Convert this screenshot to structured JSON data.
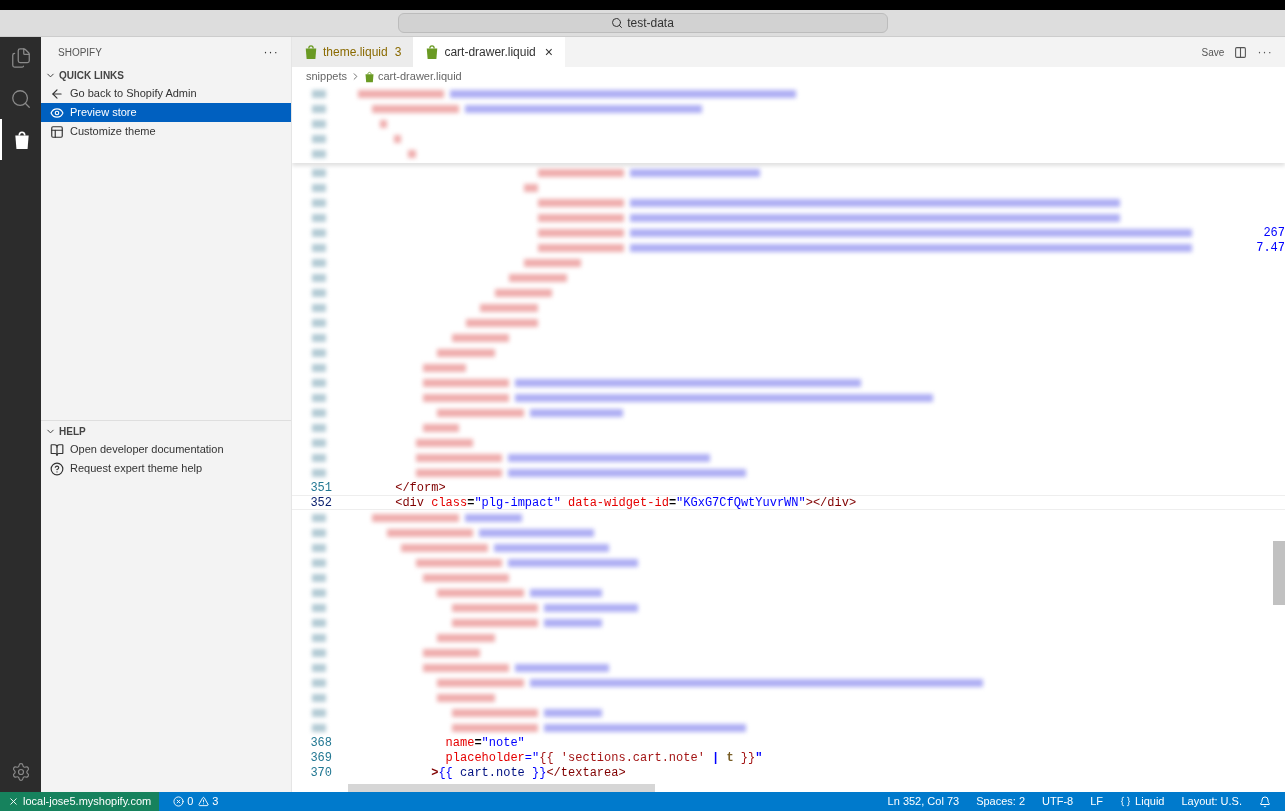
{
  "title_bar": {
    "search": "test-data"
  },
  "activity_bar": [
    {
      "kind": "files",
      "selected": false
    },
    {
      "kind": "search",
      "selected": false
    },
    {
      "kind": "shopify",
      "selected": true
    }
  ],
  "sidebar": {
    "title": "SHOPIFY",
    "more": "···",
    "sections": [
      {
        "title": "QUICK LINKS",
        "expanded": true,
        "items": [
          {
            "kind": "back",
            "label": "Go back to Shopify Admin",
            "selected": false
          },
          {
            "kind": "preview",
            "label": "Preview store",
            "selected": true
          },
          {
            "kind": "customize",
            "label": "Customize theme",
            "selected": false
          }
        ]
      },
      {
        "title": "HELP",
        "expanded": true,
        "items": [
          {
            "kind": "docs",
            "label": "Open developer documentation",
            "selected": false
          },
          {
            "kind": "help",
            "label": "Request expert theme help",
            "selected": false
          }
        ]
      }
    ]
  },
  "tabs": [
    {
      "label": "theme.liquid",
      "badge": "3",
      "selected": false
    },
    {
      "label": "cart-drawer.liquid",
      "close": "×",
      "selected": true
    }
  ],
  "editor_actions": {
    "save": "Save",
    "more": "···"
  },
  "breadcrumb": [
    "snippets",
    "cart-drawer.liquid"
  ],
  "sticky_lines": [
    {
      "kind": "blurred"
    },
    {
      "kind": "blurred"
    },
    {
      "kind": "blurred"
    },
    {
      "kind": "blurred"
    },
    {
      "kind": "blurred"
    }
  ],
  "code_lines": [
    {
      "kind": "blurred"
    },
    {
      "kind": "blurred"
    },
    {
      "kind": "blurred"
    },
    {
      "kind": "blurred"
    },
    {
      "kind": "blurred",
      "tail": "267"
    },
    {
      "kind": "blurred",
      "tail": "7.47"
    },
    {
      "kind": "blurred"
    },
    {
      "kind": "blurred"
    },
    {
      "kind": "blurred"
    },
    {
      "kind": "blurred"
    },
    {
      "kind": "blurred"
    },
    {
      "kind": "blurred"
    },
    {
      "kind": "blurred"
    },
    {
      "kind": "blurred"
    },
    {
      "kind": "blurred"
    },
    {
      "kind": "blurred"
    },
    {
      "kind": "blurred"
    },
    {
      "kind": "blurred"
    },
    {
      "kind": "blurred"
    },
    {
      "kind": "blurred"
    },
    {
      "kind": "blurred"
    },
    {
      "kind": "code",
      "number": "351",
      "current": false,
      "tokens": [
        {
          "text": "</form>",
          "color": "#800000"
        }
      ]
    },
    {
      "kind": "code",
      "number": "352",
      "current": true,
      "tokens": [
        {
          "text": "<div",
          "color": "#800000"
        },
        {
          "text": " class",
          "color": "#e50000"
        },
        {
          "text": "=",
          "color": "#000000"
        },
        {
          "text": "\"plg-impact\"",
          "color": "#0000ff"
        },
        {
          "text": " data-widget-id",
          "color": "#e50000"
        },
        {
          "text": "=",
          "color": "#000000"
        },
        {
          "text": "\"KGxG7CfQwtYuvrWN\"",
          "color": "#0000ff"
        },
        {
          "text": "></div>",
          "color": "#800000"
        }
      ]
    },
    {
      "kind": "blurred"
    },
    {
      "kind": "blurred"
    },
    {
      "kind": "blurred"
    },
    {
      "kind": "blurred"
    },
    {
      "kind": "blurred"
    },
    {
      "kind": "blurred"
    },
    {
      "kind": "blurred"
    },
    {
      "kind": "blurred"
    },
    {
      "kind": "blurred"
    },
    {
      "kind": "blurred"
    },
    {
      "kind": "blurred"
    },
    {
      "kind": "blurred"
    },
    {
      "kind": "blurred"
    },
    {
      "kind": "blurred"
    },
    {
      "kind": "blurred"
    },
    {
      "kind": "code",
      "number": "368",
      "current": false,
      "tokens": [
        {
          "text": "name",
          "color": "#e50000"
        },
        {
          "text": "=",
          "color": "#000000"
        },
        {
          "text": "\"note\"",
          "color": "#0000ff"
        }
      ]
    },
    {
      "kind": "code",
      "number": "369",
      "current": false,
      "tokens": [
        {
          "text": "placeholder",
          "color": "#e50000"
        },
        {
          "text": "=\"",
          "color": "#0000ff"
        },
        {
          "text": "{{ 'sections.cart.note' ",
          "color": "#a31515"
        },
        {
          "text": "|",
          "color": "#0000ff"
        },
        {
          "text": " t ",
          "color": "#795e26"
        },
        {
          "text": "}}",
          "color": "#a31515"
        },
        {
          "text": "\"",
          "color": "#0000ff"
        }
      ]
    },
    {
      "kind": "code",
      "number": "370",
      "current": false,
      "tokens": [
        {
          "text": ">",
          "color": "#800000"
        },
        {
          "text": "{{",
          "color": "#0000ff"
        },
        {
          "text": " cart.note ",
          "color": "#001080"
        },
        {
          "text": "}}",
          "color": "#0000ff"
        },
        {
          "text": "</textarea>",
          "color": "#800000"
        }
      ]
    }
  ],
  "status_bar": {
    "remote": "local-jose5.myshopify.com",
    "errors": "0",
    "warnings": "3",
    "items": [
      "Ln 352, Col 73",
      "Spaces: 2",
      "UTF-8",
      "LF",
      "Liquid",
      "Layout: U.S."
    ]
  }
}
